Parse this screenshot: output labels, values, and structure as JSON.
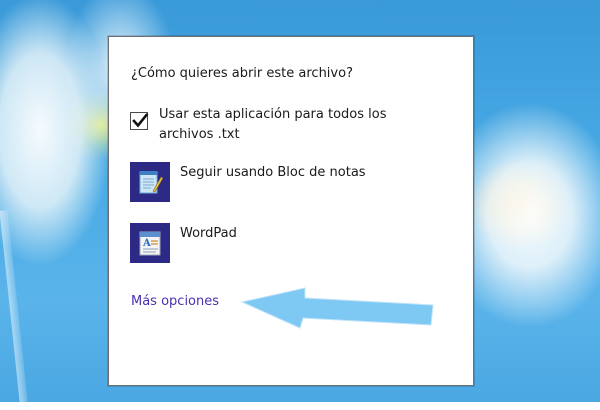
{
  "dialog": {
    "title": "¿Cómo quieres abrir este archivo?",
    "checkbox": {
      "label": "Usar esta aplicación para todos los archivos .txt",
      "checked": true
    },
    "apps": [
      {
        "label": "Seguir usando Bloc de notas",
        "icon": "notepad-icon"
      },
      {
        "label": "WordPad",
        "icon": "wordpad-icon"
      }
    ],
    "more_link": "Más opciones"
  },
  "colors": {
    "app_tile": "#2d2a86",
    "link": "#4b2fb0",
    "annotation_arrow": "#7ec8f4",
    "desktop_bg": "#47a9e4"
  }
}
